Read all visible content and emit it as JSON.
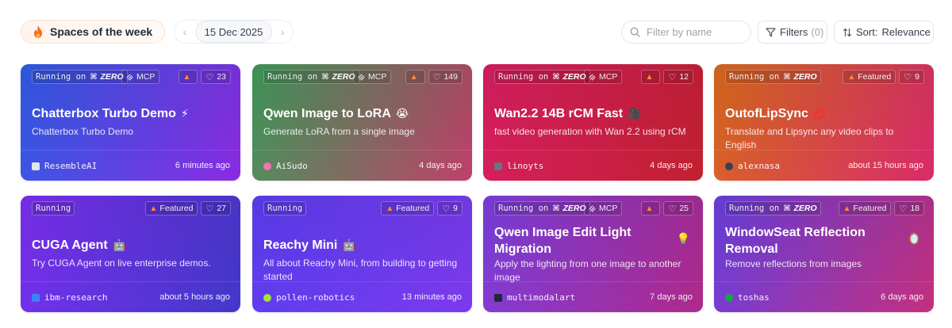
{
  "header": {
    "spaces_of_week": "Spaces of the week",
    "date": "15 Dec 2025",
    "prev_arrow": "‹",
    "next_arrow": "›",
    "search_placeholder": "Filter by name",
    "filters_label": "Filters",
    "filters_count": "(0)",
    "sort_label": "Sort:",
    "sort_value": "Relevance"
  },
  "cards": [
    {
      "running": "Running on",
      "zero": "ZERO",
      "zero_icon": "⌘",
      "mcp": "MCP",
      "featured": "",
      "likes": "23",
      "title": "Chatterbox Turbo Demo",
      "emoji": "⚡",
      "description": "Chatterbox Turbo Demo",
      "owner": "ResembleAI",
      "time": "6 minutes ago",
      "gradient": [
        "#2f5ce6",
        "#8a2be2"
      ],
      "avatar_color": "#e5e7eb"
    },
    {
      "running": "Running on",
      "zero": "ZERO",
      "zero_icon": "⌘",
      "mcp": "MCP",
      "featured": "",
      "likes": "149",
      "title": "Qwen Image to LoRA",
      "emoji": "😭",
      "description": "Generate LoRA from a single image",
      "owner": "AiSudo",
      "time": "4 days ago",
      "gradient": [
        "#3f9a5a",
        "#c0406a"
      ],
      "avatar_color": "#f472b6"
    },
    {
      "running": "Running on",
      "zero": "ZERO",
      "zero_icon": "⌘",
      "mcp": "MCP",
      "featured": "",
      "likes": "12",
      "title": "Wan2.2 14B rCM Fast",
      "emoji": "🎥",
      "description": "fast video generation with Wan 2.2 using rCM",
      "owner": "linoyts",
      "time": "4 days ago",
      "gradient": [
        "#d91e63",
        "#c2202f"
      ],
      "avatar_color": "#6b7280"
    },
    {
      "running": "Running on",
      "zero": "ZERO",
      "zero_icon": "⌘",
      "mcp": "",
      "featured": "Featured",
      "likes": "9",
      "title": "OutofLipSync",
      "emoji": "💋",
      "description": "Translate and Lipsync any video clips to English",
      "owner": "alexnasa",
      "time": "about 15 hours ago",
      "gradient": [
        "#d96a1e",
        "#d92a6b"
      ],
      "avatar_color": "#374151"
    },
    {
      "running": "Running",
      "zero": "",
      "zero_icon": "",
      "mcp": "",
      "featured": "Featured",
      "likes": "27",
      "title": "CUGA Agent",
      "emoji": "🤖",
      "description": "Try CUGA Agent on live enterprise demos.",
      "owner": "ibm-research",
      "time": "about 5 hours ago",
      "gradient": [
        "#7b2ff0",
        "#4338ca"
      ],
      "avatar_color": "#3b82f6"
    },
    {
      "running": "Running",
      "zero": "",
      "zero_icon": "",
      "mcp": "",
      "featured": "Featured",
      "likes": "9",
      "title": "Reachy Mini",
      "emoji": "🤖",
      "description": "All about Reachy Mini, from building to getting started",
      "owner": "pollen-robotics",
      "time": "13 minutes ago",
      "gradient": [
        "#5b3df0",
        "#7c3aed"
      ],
      "avatar_color": "#a3e635"
    },
    {
      "running": "Running on",
      "zero": "ZERO",
      "zero_icon": "⌘",
      "mcp": "MCP",
      "featured": "",
      "likes": "25",
      "title": "Qwen Image Edit Light Migration",
      "emoji": "💡",
      "description": "Apply the lighting from one image to another image",
      "owner": "multimodalart",
      "time": "7 days ago",
      "gradient": [
        "#7a3fe0",
        "#b0298a"
      ],
      "avatar_color": "#1f2937"
    },
    {
      "running": "Running on",
      "zero": "ZERO",
      "zero_icon": "⌘",
      "mcp": "",
      "featured": "Featured",
      "likes": "18",
      "title": "WindowSeat Reflection Removal",
      "emoji": "🪞",
      "description": "Remove reflections from images",
      "owner": "toshas",
      "time": "6 days ago",
      "gradient": [
        "#6a3fe0",
        "#c4307e"
      ],
      "avatar_color": "#16a34a"
    }
  ]
}
